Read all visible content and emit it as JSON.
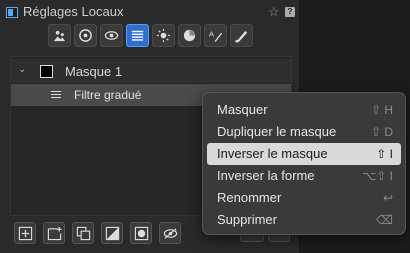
{
  "panel": {
    "title": "Réglages Locaux",
    "star_icon": "star-icon",
    "help_label": "?"
  },
  "tools": [
    {
      "name": "tool-people-icon"
    },
    {
      "name": "tool-target-icon"
    },
    {
      "name": "tool-eye-icon"
    },
    {
      "name": "tool-gradient-icon",
      "active": true
    },
    {
      "name": "tool-brightness-icon"
    },
    {
      "name": "tool-color-icon"
    },
    {
      "name": "tool-text-brush-icon"
    },
    {
      "name": "tool-brush-icon"
    }
  ],
  "layers": {
    "mask_name": "Masque 1",
    "filter_name": "Filtre gradué"
  },
  "menu": {
    "items": [
      {
        "label": "Masquer",
        "shortcut": "⇧ H",
        "highlight": false
      },
      {
        "label": "Dupliquer le masque",
        "shortcut": "⇧ D",
        "highlight": false
      },
      {
        "label": "Inverser le masque",
        "shortcut": "⇧ I",
        "highlight": true
      },
      {
        "label": "Inverser la forme",
        "shortcut": "⌥⇧ I",
        "highlight": false
      },
      {
        "label": "Renommer",
        "shortcut": "↩",
        "highlight": false
      },
      {
        "label": "Supprimer",
        "shortcut": "⌫",
        "highlight": false
      }
    ]
  },
  "colors": {
    "accent": "#2f6fd0",
    "menu_bg": "#3a3a3a",
    "highlight": "#d9d9d9"
  }
}
